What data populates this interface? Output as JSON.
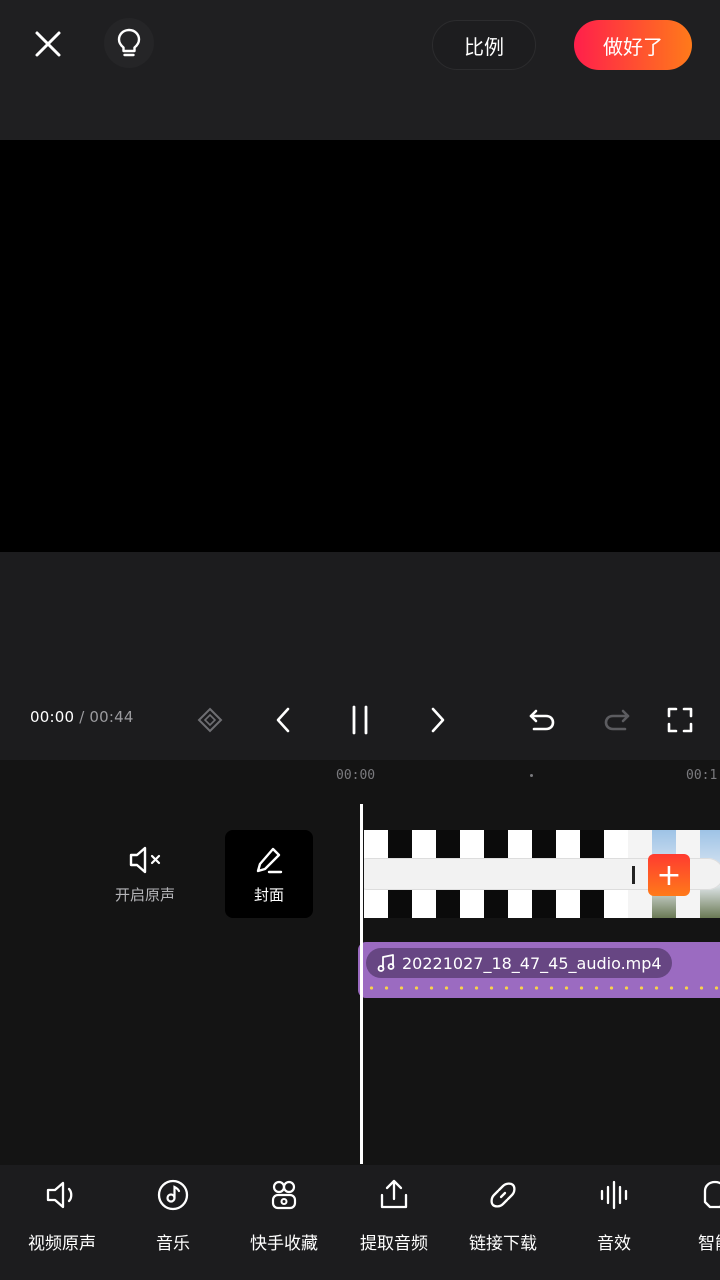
{
  "header": {
    "ratio_label": "比例",
    "done_label": "做好了",
    "done_gradient": [
      "#ff1f4b",
      "#ff7a1a"
    ]
  },
  "player": {
    "current_time": "00:00",
    "total_time": " / 00:44"
  },
  "timeline": {
    "ruler_labels": [
      "00:00",
      "00:1"
    ],
    "mute_label": "开启原声",
    "cover_label": "封面",
    "audio_clip_name": "20221027_18_47_45_audio.mp4",
    "audio_color": "#9b6bc1"
  },
  "toolbar": {
    "items": [
      {
        "label": "视频原声",
        "icon": "speaker-icon"
      },
      {
        "label": "音乐",
        "icon": "music-disc-icon"
      },
      {
        "label": "快手收藏",
        "icon": "favorites-icon"
      },
      {
        "label": "提取音频",
        "icon": "upload-extract-icon"
      },
      {
        "label": "链接下载",
        "icon": "link-icon"
      },
      {
        "label": "音效",
        "icon": "sound-wave-icon"
      },
      {
        "label": "智能",
        "icon": "smart-icon"
      }
    ]
  }
}
